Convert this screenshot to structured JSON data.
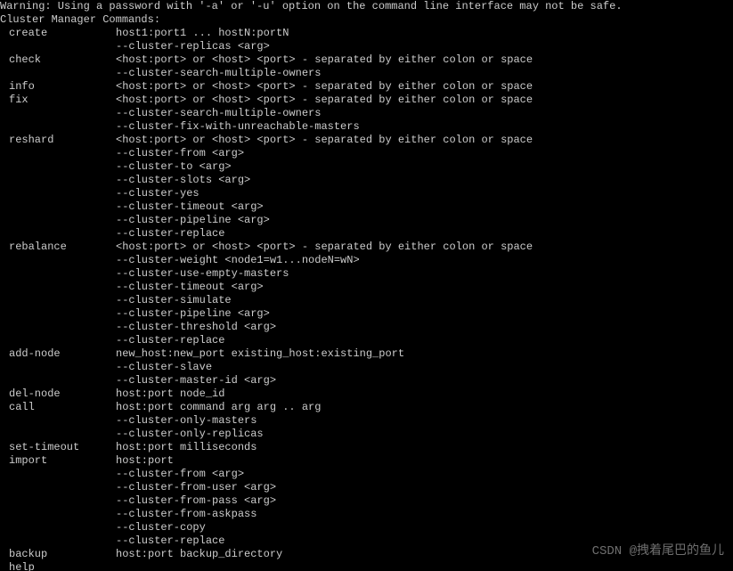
{
  "warning": "Warning: Using a password with '-a' or '-u' option on the command line interface may not be safe.",
  "section": "Cluster Manager Commands:",
  "rows": [
    {
      "cmd": "create",
      "lines": [
        "host1:port1 ... hostN:portN",
        "--cluster-replicas <arg>"
      ]
    },
    {
      "cmd": "check",
      "lines": [
        "<host:port> or <host> <port> - separated by either colon or space",
        "--cluster-search-multiple-owners"
      ]
    },
    {
      "cmd": "info",
      "lines": [
        "<host:port> or <host> <port> - separated by either colon or space"
      ]
    },
    {
      "cmd": "fix",
      "lines": [
        "<host:port> or <host> <port> - separated by either colon or space",
        "--cluster-search-multiple-owners",
        "--cluster-fix-with-unreachable-masters"
      ]
    },
    {
      "cmd": "reshard",
      "lines": [
        "<host:port> or <host> <port> - separated by either colon or space",
        "--cluster-from <arg>",
        "--cluster-to <arg>",
        "--cluster-slots <arg>",
        "--cluster-yes",
        "--cluster-timeout <arg>",
        "--cluster-pipeline <arg>",
        "--cluster-replace"
      ]
    },
    {
      "cmd": "rebalance",
      "lines": [
        "<host:port> or <host> <port> - separated by either colon or space",
        "--cluster-weight <node1=w1...nodeN=wN>",
        "--cluster-use-empty-masters",
        "--cluster-timeout <arg>",
        "--cluster-simulate",
        "--cluster-pipeline <arg>",
        "--cluster-threshold <arg>",
        "--cluster-replace"
      ]
    },
    {
      "cmd": "add-node",
      "lines": [
        "new_host:new_port existing_host:existing_port",
        "--cluster-slave",
        "--cluster-master-id <arg>"
      ]
    },
    {
      "cmd": "del-node",
      "lines": [
        "host:port node_id"
      ]
    },
    {
      "cmd": "call",
      "lines": [
        "host:port command arg arg .. arg",
        "--cluster-only-masters",
        "--cluster-only-replicas"
      ]
    },
    {
      "cmd": "set-timeout",
      "lines": [
        "host:port milliseconds"
      ]
    },
    {
      "cmd": "import",
      "lines": [
        "host:port",
        "--cluster-from <arg>",
        "--cluster-from-user <arg>",
        "--cluster-from-pass <arg>",
        "--cluster-from-askpass",
        "--cluster-copy",
        "--cluster-replace"
      ]
    },
    {
      "cmd": "backup",
      "lines": [
        "host:port backup_directory"
      ]
    },
    {
      "cmd": "help",
      "lines": [
        ""
      ]
    }
  ],
  "watermark": "CSDN @拽着尾巴的鱼儿"
}
